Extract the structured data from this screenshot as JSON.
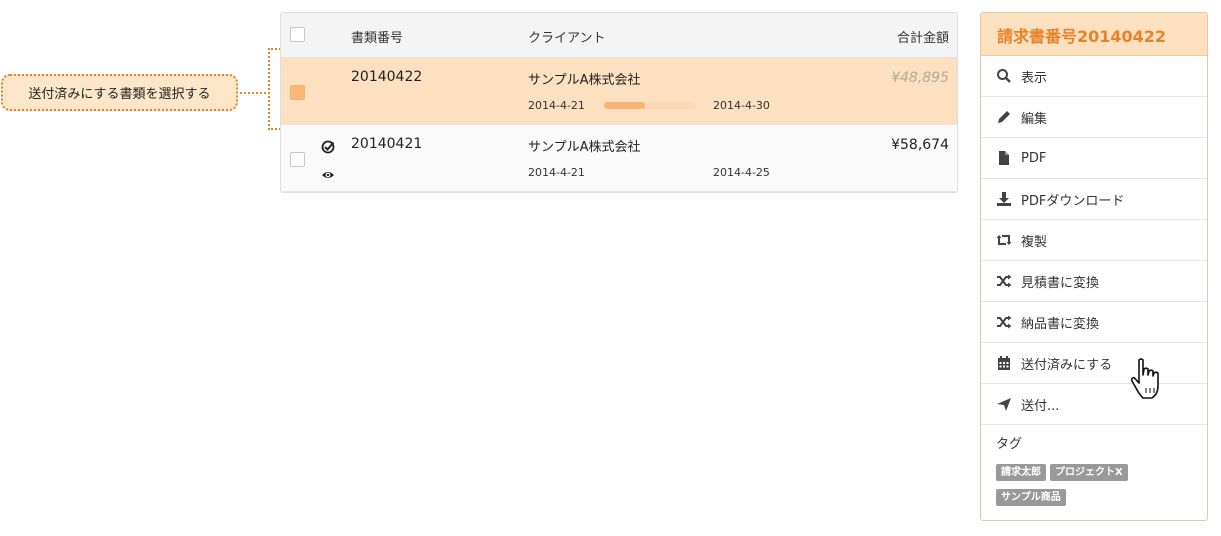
{
  "callout": {
    "text": "送付済みにする書類を選択する"
  },
  "table": {
    "headers": {
      "number": "書類番号",
      "client": "クライアント",
      "total": "合計金額"
    },
    "rows": [
      {
        "number": "20140422",
        "client": "サンプルA株式会社",
        "date_start": "2014-4-21",
        "date_end": "2014-4-30",
        "amount": "¥48,895",
        "progress_pct": 45,
        "selected": true
      },
      {
        "number": "20140421",
        "client": "サンプルA株式会社",
        "date_start": "2014-4-21",
        "date_end": "2014-4-25",
        "amount": "¥58,674",
        "selected": false
      }
    ]
  },
  "panel": {
    "title": "請求書番号20140422",
    "menu": [
      {
        "label": "表示",
        "icon": "search-icon"
      },
      {
        "label": "編集",
        "icon": "pencil-icon"
      },
      {
        "label": "PDF",
        "icon": "file-icon"
      },
      {
        "label": "PDFダウンロード",
        "icon": "download-icon"
      },
      {
        "label": "複製",
        "icon": "retweet-icon"
      },
      {
        "label": "見積書に変換",
        "icon": "shuffle-icon"
      },
      {
        "label": "納品書に変換",
        "icon": "shuffle-icon"
      },
      {
        "label": "送付済みにする",
        "icon": "calendar-icon"
      },
      {
        "label": "送付...",
        "icon": "send-icon"
      }
    ],
    "tags_title": "タグ",
    "tags": [
      "請求太郎",
      "プロジェクトX",
      "サンプル商品"
    ]
  },
  "colors": {
    "accent": "#e8832b",
    "selected_row": "#fde0c0",
    "tag_bg": "#999999"
  }
}
